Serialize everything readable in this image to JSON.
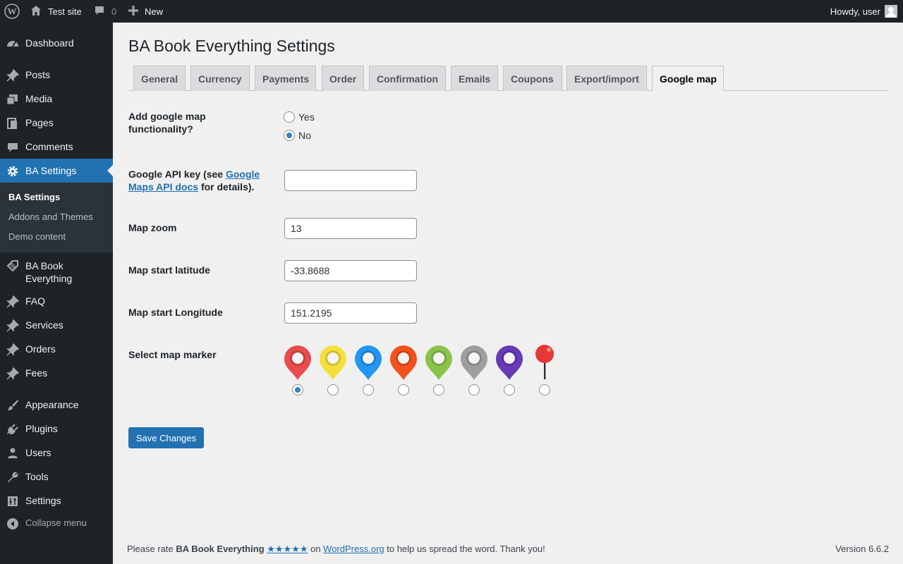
{
  "admin_bar": {
    "site_name": "Test site",
    "comments_count": "0",
    "new_label": "New",
    "howdy": "Howdy, user"
  },
  "sidebar": {
    "items": [
      {
        "label": "Dashboard",
        "icon": "dashboard-icon"
      },
      {
        "label": "Posts",
        "icon": "pushpin-icon"
      },
      {
        "label": "Media",
        "icon": "media-icon"
      },
      {
        "label": "Pages",
        "icon": "pages-icon"
      },
      {
        "label": "Comments",
        "icon": "comment-icon"
      },
      {
        "label": "BA Settings",
        "icon": "gear-icon"
      },
      {
        "label": "BA Book Everything",
        "icon": "tag-icon"
      },
      {
        "label": "FAQ",
        "icon": "pushpin-icon"
      },
      {
        "label": "Services",
        "icon": "pushpin-icon"
      },
      {
        "label": "Orders",
        "icon": "pushpin-icon"
      },
      {
        "label": "Fees",
        "icon": "pushpin-icon"
      },
      {
        "label": "Appearance",
        "icon": "brush-icon"
      },
      {
        "label": "Plugins",
        "icon": "plugin-icon"
      },
      {
        "label": "Users",
        "icon": "users-icon"
      },
      {
        "label": "Tools",
        "icon": "wrench-icon"
      },
      {
        "label": "Settings",
        "icon": "settings-icon"
      }
    ],
    "submenu": [
      "BA Settings",
      "Addons and Themes",
      "Demo content"
    ],
    "collapse_label": "Collapse menu"
  },
  "page": {
    "title": "BA Book Everything Settings",
    "tabs": [
      "General",
      "Currency",
      "Payments",
      "Order",
      "Confirmation",
      "Emails",
      "Coupons",
      "Export/import",
      "Google map"
    ],
    "active_tab": "Google map"
  },
  "form": {
    "google_map": {
      "label": "Add google map functionality?",
      "options": [
        "Yes",
        "No"
      ],
      "selected": "No"
    },
    "api_key": {
      "label_prefix": "Google API key (see ",
      "link_text": "Google Maps API docs",
      "label_suffix": " for details).",
      "value": ""
    },
    "zoom": {
      "label": "Map zoom",
      "value": "13"
    },
    "latitude": {
      "label": "Map start latitude",
      "value": "-33.8688"
    },
    "longitude": {
      "label": "Map start Longitude",
      "value": "151.2195"
    },
    "marker": {
      "label": "Select map marker",
      "options": [
        {
          "name": "red-marker-icon",
          "color": "#e84c4c"
        },
        {
          "name": "yellow-marker-icon",
          "color": "#f5e03b"
        },
        {
          "name": "blue-marker-icon",
          "color": "#2196f3"
        },
        {
          "name": "orange-marker-icon",
          "color": "#f4511e"
        },
        {
          "name": "green-marker-icon",
          "color": "#8bc34a"
        },
        {
          "name": "gray-marker-icon",
          "color": "#9e9e9e"
        },
        {
          "name": "purple-marker-icon",
          "color": "#673ab7"
        },
        {
          "name": "red-pushpin-icon",
          "color": "#e53935"
        }
      ],
      "selected_index": 0
    },
    "save_label": "Save Changes"
  },
  "footer": {
    "rate_prefix": "Please rate ",
    "plugin_name": "BA Book Everything",
    "stars": "★★★★★",
    "on": " on ",
    "wporg": "WordPress.org",
    "suffix": " to help us spread the word. Thank you!",
    "version": "Version 6.6.2"
  },
  "colors": {
    "accent": "#2271b1",
    "sidebar_bg": "#1d2327",
    "submenu_bg": "#2c3338"
  }
}
